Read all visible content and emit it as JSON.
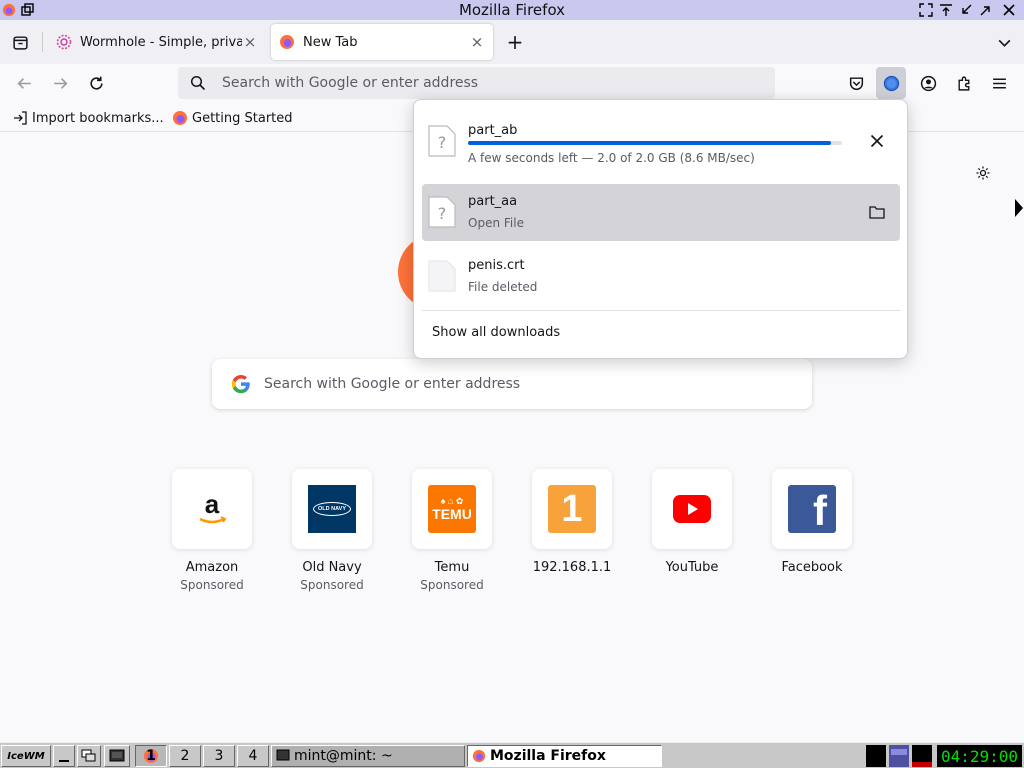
{
  "window": {
    "title": "Mozilla Firefox"
  },
  "tabs": [
    {
      "label": "Wormhole - Simple, private",
      "icon": "wormhole-icon",
      "active": false
    },
    {
      "label": "New Tab",
      "icon": "firefox-icon",
      "active": true
    }
  ],
  "tabstrip": {
    "new_tab": "+",
    "close": "×"
  },
  "urlbar": {
    "placeholder": "Search with Google or enter address"
  },
  "bookmarks": [
    {
      "label": "Import bookmarks...",
      "icon": "import-icon"
    },
    {
      "label": "Getting Started",
      "icon": "firefox-icon"
    }
  ],
  "newtab": {
    "search_placeholder": "Search with Google or enter address",
    "top_sites": [
      {
        "name": "Amazon",
        "sub": "Sponsored",
        "icon": "amazon-logo"
      },
      {
        "name": "Old Navy",
        "sub": "Sponsored",
        "icon": "old-navy-logo",
        "logo_text": "OLD NAVY"
      },
      {
        "name": "Temu",
        "sub": "Sponsored",
        "icon": "temu-logo",
        "logo_text": "TEMU"
      },
      {
        "name": "192.168.1.1",
        "sub": "",
        "icon": "router-logo",
        "logo_text": "1"
      },
      {
        "name": "YouTube",
        "sub": "",
        "icon": "youtube-logo"
      },
      {
        "name": "Facebook",
        "sub": "",
        "icon": "facebook-logo",
        "logo_text": "f"
      }
    ]
  },
  "downloads": {
    "items": [
      {
        "name": "part_ab",
        "status": "A few seconds left — 2.0 of 2.0 GB (8.6 MB/sec)",
        "progress": 0.97,
        "action": "cancel",
        "state": "downloading"
      },
      {
        "name": "part_aa",
        "status": "Open File",
        "action": "show-in-folder",
        "state": "complete"
      },
      {
        "name": "penis.crt",
        "status": "File deleted",
        "state": "deleted"
      }
    ],
    "show_all": "Show all downloads"
  },
  "taskbar": {
    "start": "IceWM",
    "workspaces": [
      "1",
      "2",
      "3",
      "4"
    ],
    "tasks": [
      {
        "label": "mint@mint: ~",
        "icon": "terminal-icon",
        "active": false
      },
      {
        "label": "Mozilla Firefox",
        "icon": "firefox-icon",
        "active": true
      }
    ],
    "clock": "04:29:00"
  },
  "colors": {
    "accent": "#0061e0",
    "titlebar": "#c9c9f0",
    "taskbar": "#c8c8c8",
    "clock_fg": "#00e000"
  }
}
